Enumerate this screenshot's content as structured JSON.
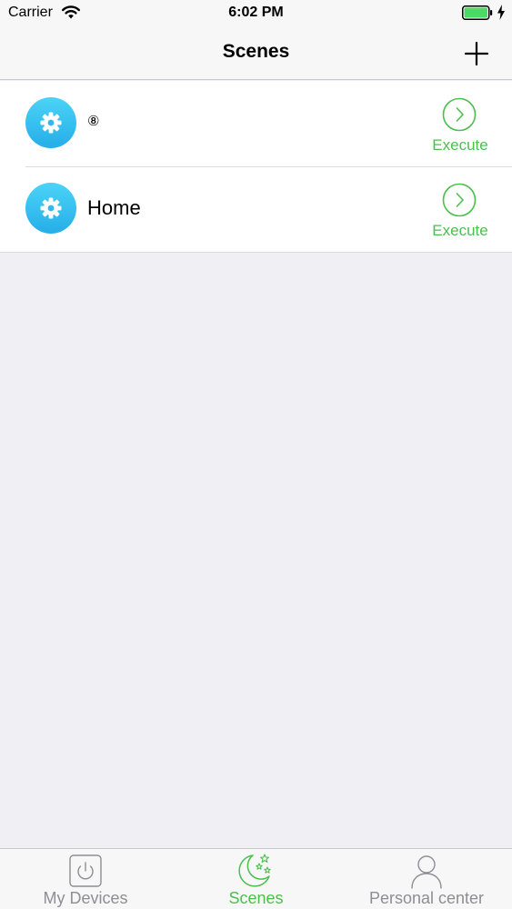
{
  "status_bar": {
    "carrier": "Carrier",
    "time": "6:02 PM",
    "battery_color": "#4cd964"
  },
  "nav": {
    "title": "Scenes",
    "add_icon": "plus-icon"
  },
  "scenes": [
    {
      "name": "⑧",
      "execute_label": "Execute",
      "icon": "gear-icon"
    },
    {
      "name": "Home",
      "execute_label": "Execute",
      "icon": "gear-icon"
    }
  ],
  "tab_bar": {
    "tabs": [
      {
        "label": "My Devices",
        "icon": "power-icon",
        "active": false
      },
      {
        "label": "Scenes",
        "icon": "moon-stars-icon",
        "active": true
      },
      {
        "label": "Personal center",
        "icon": "person-icon",
        "active": false
      }
    ]
  },
  "colors": {
    "accent": "#4cbf4f",
    "scene_icon": "#2fb9ee",
    "background": "#efeff4"
  }
}
